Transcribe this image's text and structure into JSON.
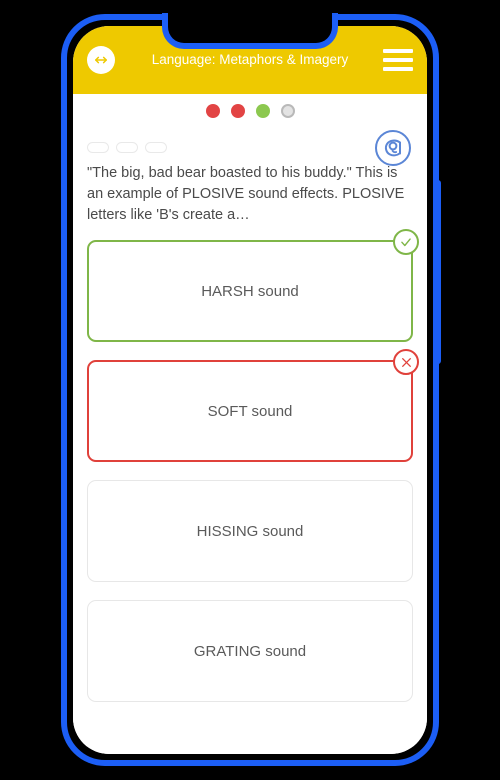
{
  "header": {
    "title": "Language: Metaphors & Imagery",
    "back_icon": "left-right-arrow-icon",
    "menu_icon": "hamburger-menu-icon",
    "background_color": "#eec900",
    "title_color": "#ffffff"
  },
  "progress": {
    "dots": [
      {
        "state": "incorrect",
        "color": "#e24444"
      },
      {
        "state": "incorrect",
        "color": "#e24444"
      },
      {
        "state": "correct",
        "color": "#8cc84f"
      },
      {
        "state": "current",
        "color": "#e3e3e3"
      }
    ]
  },
  "question": {
    "pills": 3,
    "audio_icon": "audio-listen-icon",
    "audio_icon_color": "#5b86d6",
    "text": "\"The big, bad bear boasted to his buddy.\" This is an example of PLOSIVE sound effects. PLOSIVE letters like 'B's create a…"
  },
  "options": [
    {
      "label": "HARSH sound",
      "state": "correct",
      "badge": "check-icon",
      "badge_color": "#7fb648"
    },
    {
      "label": "SOFT sound",
      "state": "incorrect",
      "badge": "cross-icon",
      "badge_color": "#e0413b"
    },
    {
      "label": "HISSING sound",
      "state": "neutral",
      "badge": null,
      "badge_color": null
    },
    {
      "label": "GRATING sound",
      "state": "neutral",
      "badge": null,
      "badge_color": null
    }
  ],
  "device": {
    "frame_color": "#1c5ef5",
    "screen_background": "#ffffff"
  }
}
